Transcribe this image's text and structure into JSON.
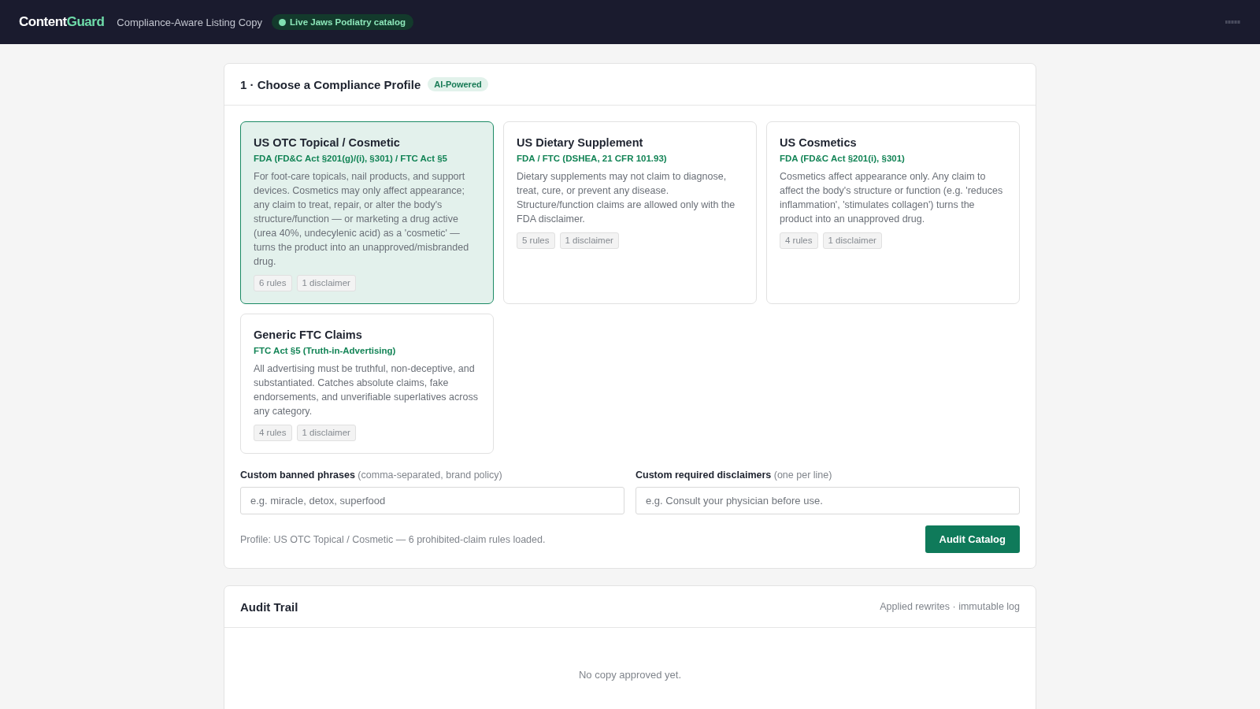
{
  "header": {
    "logo": {
      "primary": "Content",
      "accent": "Guard"
    },
    "subtitle": "Compliance-Aware Listing Copy",
    "status_pill": {
      "label": "Live Jaws Podiatry catalog"
    }
  },
  "profile_panel": {
    "title": "1 · Choose a Compliance Profile",
    "badge": "AI-Powered",
    "profiles": [
      {
        "name": "US OTC Topical / Cosmetic",
        "authority": "FDA (FD&C Act §201(g)/(i), §301) / FTC Act §5",
        "description": "For foot-care topicals, nail products, and support devices. Cosmetics may only affect appearance; any claim to treat, repair, or alter the body's structure/function — or marketing a drug active (urea 40%, undecylenic acid) as a 'cosmetic' — turns the product into an unapproved/misbranded drug.",
        "tags": [
          "6 rules",
          "1 disclaimer"
        ],
        "selected": true
      },
      {
        "name": "US Dietary Supplement",
        "authority": "FDA / FTC (DSHEA, 21 CFR 101.93)",
        "description": "Dietary supplements may not claim to diagnose, treat, cure, or prevent any disease. Structure/function claims are allowed only with the FDA disclaimer.",
        "tags": [
          "5 rules",
          "1 disclaimer"
        ],
        "selected": false
      },
      {
        "name": "US Cosmetics",
        "authority": "FDA (FD&C Act §201(i), §301)",
        "description": "Cosmetics affect appearance only. Any claim to affect the body's structure or function (e.g. 'reduces inflammation', 'stimulates collagen') turns the product into an unapproved drug.",
        "tags": [
          "4 rules",
          "1 disclaimer"
        ],
        "selected": false
      },
      {
        "name": "Generic FTC Claims",
        "authority": "FTC Act §5 (Truth-in-Advertising)",
        "description": "All advertising must be truthful, non-deceptive, and substantiated. Catches absolute claims, fake endorsements, and unverifiable superlatives across any category.",
        "tags": [
          "4 rules",
          "1 disclaimer"
        ],
        "selected": false
      }
    ],
    "fields": [
      {
        "label": "**Custom banned phrases** (comma-separated, brand policy)",
        "placeholder": "e.g. miracle, detox, superfood"
      },
      {
        "label": "**Custom required disclaimers** (one per line)",
        "placeholder": "e.g. Consult your physician before use."
      }
    ],
    "status_text": "Profile: US OTC Topical / Cosmetic — 6 prohibited-claim rules loaded.",
    "button": "Audit Catalog"
  },
  "audit_trail": {
    "title": "Audit Trail",
    "subtitle": "Applied rewrites · immutable log",
    "empty_message": "No copy approved yet."
  }
}
